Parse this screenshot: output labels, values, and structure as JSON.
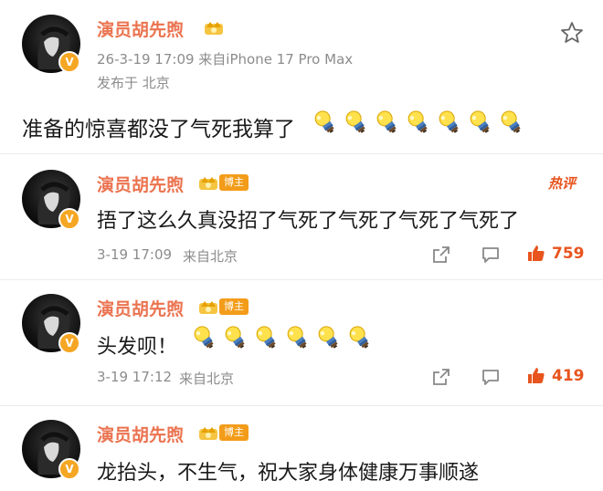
{
  "post": {
    "username": "演员胡先煦",
    "meta_line": "26-3-19 17:09  来自iPhone 17 Pro Max",
    "location": "发布于 北京",
    "text": "准备的惊喜都没了气死我算了",
    "emoji_name": "lightbulb-emoji",
    "emoji_count": 7
  },
  "comments": [
    {
      "username": "演员胡先煦",
      "tag": "博主",
      "hot_label": "热评",
      "text": "捂了这么久真没招了气死了气死了气死了气死了",
      "time": "3-19 17:09",
      "source": "来自北京",
      "likes": "759",
      "emoji_count": 0
    },
    {
      "username": "演员胡先煦",
      "tag": "博主",
      "text": "头发呗！",
      "time": "3-19 17:12",
      "source": "来自北京",
      "likes": "419",
      "emoji_count": 6
    },
    {
      "username": "演员胡先煦",
      "tag": "博主",
      "text": "龙抬头，不生气，祝大家身体健康万事顺遂",
      "emoji_count": 0
    }
  ],
  "colors": {
    "username": "#eb7350",
    "tag_bg": "#f39c1a",
    "hot": "#e8541e",
    "meta": "#8c8c8c",
    "v_badge": "#f5a623"
  },
  "icons": [
    "star-icon",
    "share-icon",
    "comment-icon",
    "like-icon",
    "crown-icon",
    "v-badge-icon"
  ]
}
